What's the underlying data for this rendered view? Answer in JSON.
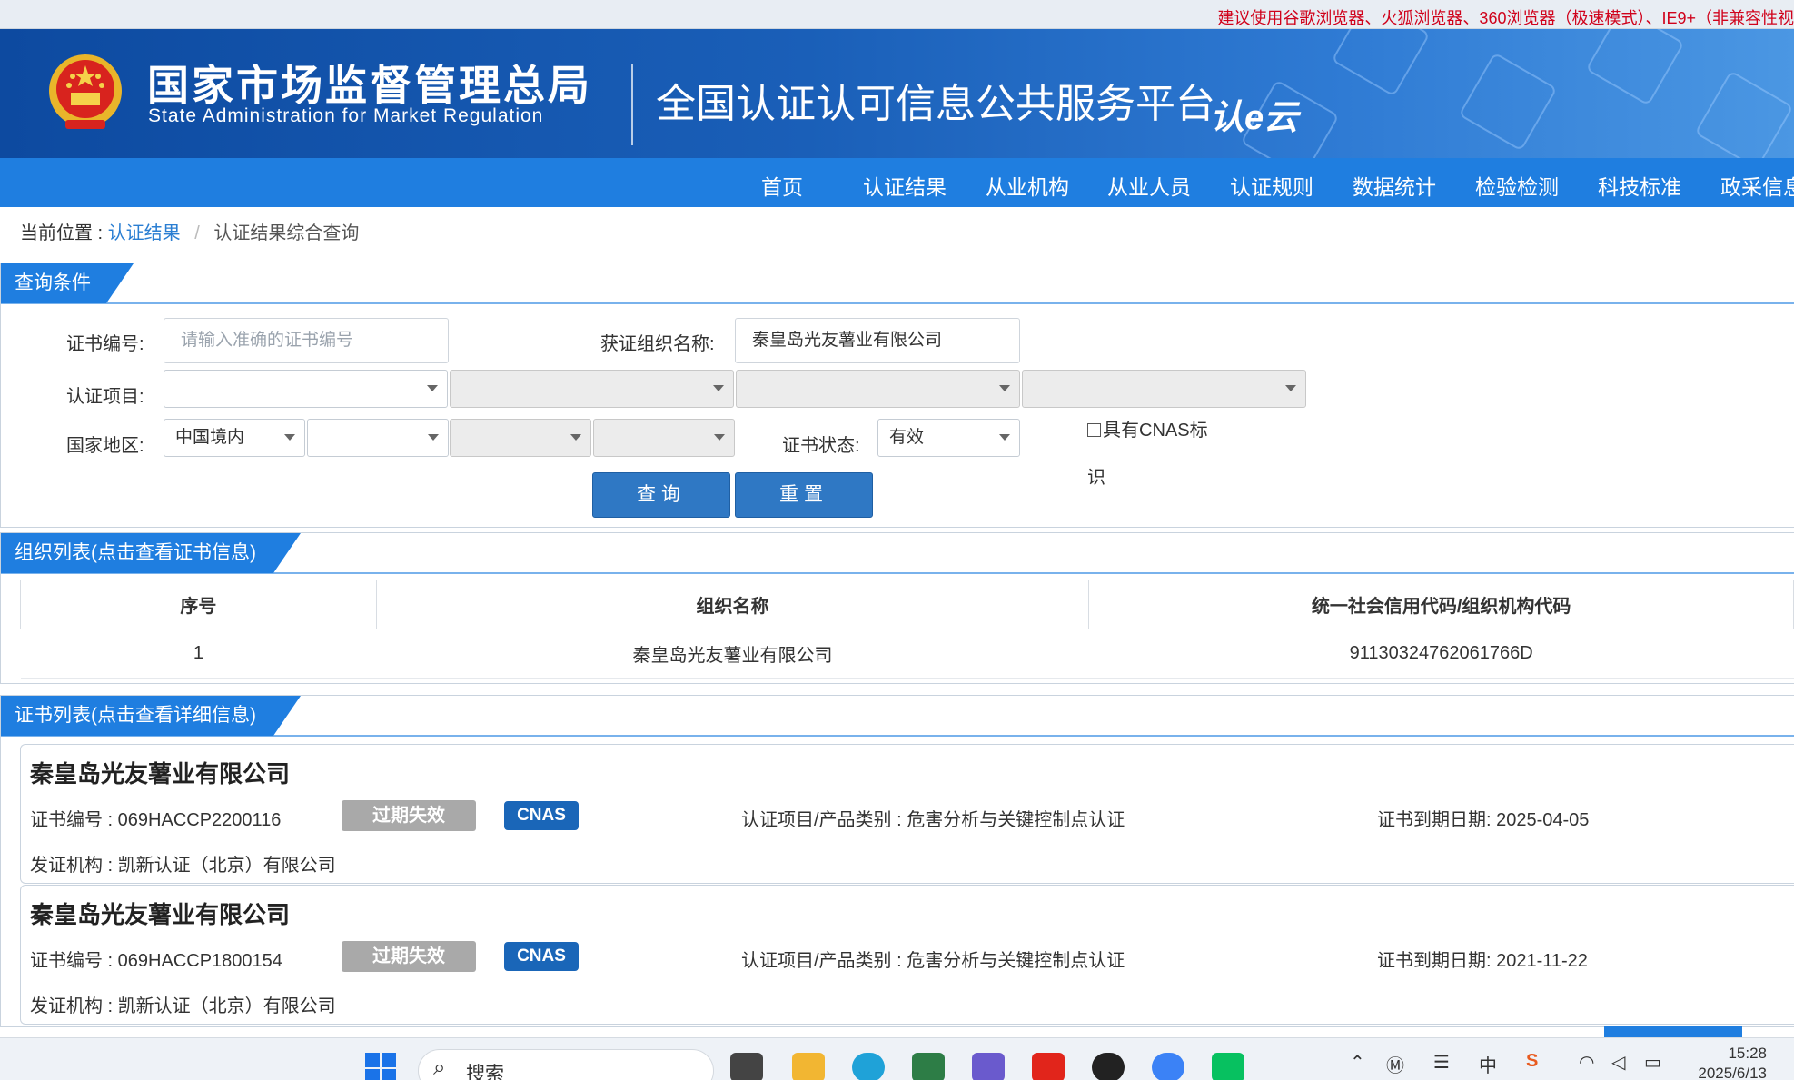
{
  "browser_notice": "建议使用谷歌浏览器、火狐浏览器、360浏览器（极速模式）、IE9+（非兼容性视",
  "header": {
    "org_cn": "国家市场监督管理总局",
    "org_en": "State Administration  for  Market Regulation",
    "platform_title": "全国认证认可信息公共服务平台",
    "logo_text": "认e云"
  },
  "nav": [
    "首页",
    "认证结果",
    "从业机构",
    "从业人员",
    "认证规则",
    "数据统计",
    "检验检测",
    "科技标准",
    "政采信息"
  ],
  "breadcrumb": {
    "prefix": "当前位置 :",
    "link": "认证结果",
    "separator": "/",
    "current": "认证结果综合查询"
  },
  "query": {
    "tab": "查询条件",
    "cert_no_label": "证书编号:",
    "cert_no_placeholder": "请输入准确的证书编号",
    "cert_no_value": "",
    "org_name_label": "获证组织名称:",
    "org_name_value": "秦皇岛光友薯业有限公司",
    "project_label": "认证项目:",
    "region_label": "国家地区:",
    "region_value": "中国境内",
    "status_label": "证书状态:",
    "status_value": "有效",
    "cnas_label": "具有CNAS标识",
    "search_btn": "查询",
    "reset_btn": "重置"
  },
  "org_list": {
    "tab": "组织列表(点击查看证书信息)",
    "columns": [
      "序号",
      "组织名称",
      "统一社会信用代码/组织机构代码"
    ],
    "rows": [
      {
        "index": "1",
        "name": "秦皇岛光友薯业有限公司",
        "code": "91130324762061766D"
      }
    ]
  },
  "cert_list": {
    "tab": "证书列表(点击查看详细信息)",
    "items": [
      {
        "org": "秦皇岛光友薯业有限公司",
        "cert_no": "证书编号 : 069HACCP2200116",
        "status": "过期失效",
        "cnas": "CNAS",
        "project": "认证项目/产品类别 : 危害分析与关键控制点认证",
        "expiry": "证书到期日期: 2025-04-05",
        "issuer": "发证机构 : 凯新认证（北京）有限公司"
      },
      {
        "org": "秦皇岛光友薯业有限公司",
        "cert_no": "证书编号 : 069HACCP1800154",
        "status": "过期失效",
        "cnas": "CNAS",
        "project": "认证项目/产品类别 : 危害分析与关键控制点认证",
        "expiry": "证书到期日期: 2021-11-22",
        "issuer": "发证机构 : 凯新认证（北京）有限公司"
      }
    ]
  },
  "taskbar": {
    "search_text": "搜索",
    "ime": "中",
    "time": "15:28",
    "date": "2025/6/13"
  },
  "colors": {
    "brand_blue": "#1f7ee0",
    "banner_blue": "#0d4aa0",
    "notice_red": "#d0021b",
    "badge_grey": "#a9a9a9",
    "cnas_blue": "#1a66b8"
  }
}
